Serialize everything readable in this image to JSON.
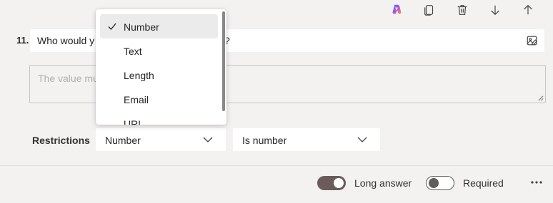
{
  "toolbar": {
    "icons": [
      "copilot-icon",
      "copy-icon",
      "delete-icon",
      "arrow-down-icon",
      "arrow-up-icon"
    ]
  },
  "question": {
    "number": "11.",
    "text_visible_start": "Who would y",
    "text_visible_end": "?"
  },
  "answer": {
    "placeholder_visible": "The value mu"
  },
  "restrictions": {
    "label": "Restrictions",
    "type_value": "Number",
    "condition_value": "Is number"
  },
  "dropdown": {
    "items": [
      {
        "label": "Number",
        "selected": true
      },
      {
        "label": "Text",
        "selected": false
      },
      {
        "label": "Length",
        "selected": false
      },
      {
        "label": "Email",
        "selected": false
      },
      {
        "label": "URL",
        "selected": false
      }
    ]
  },
  "footer": {
    "long_answer_label": "Long answer",
    "long_answer_on": true,
    "required_label": "Required",
    "required_on": false
  },
  "colors": {
    "background": "#f3f2f1",
    "toggle_on": "#6b5b5b",
    "selected_item": "#ebebeb"
  }
}
